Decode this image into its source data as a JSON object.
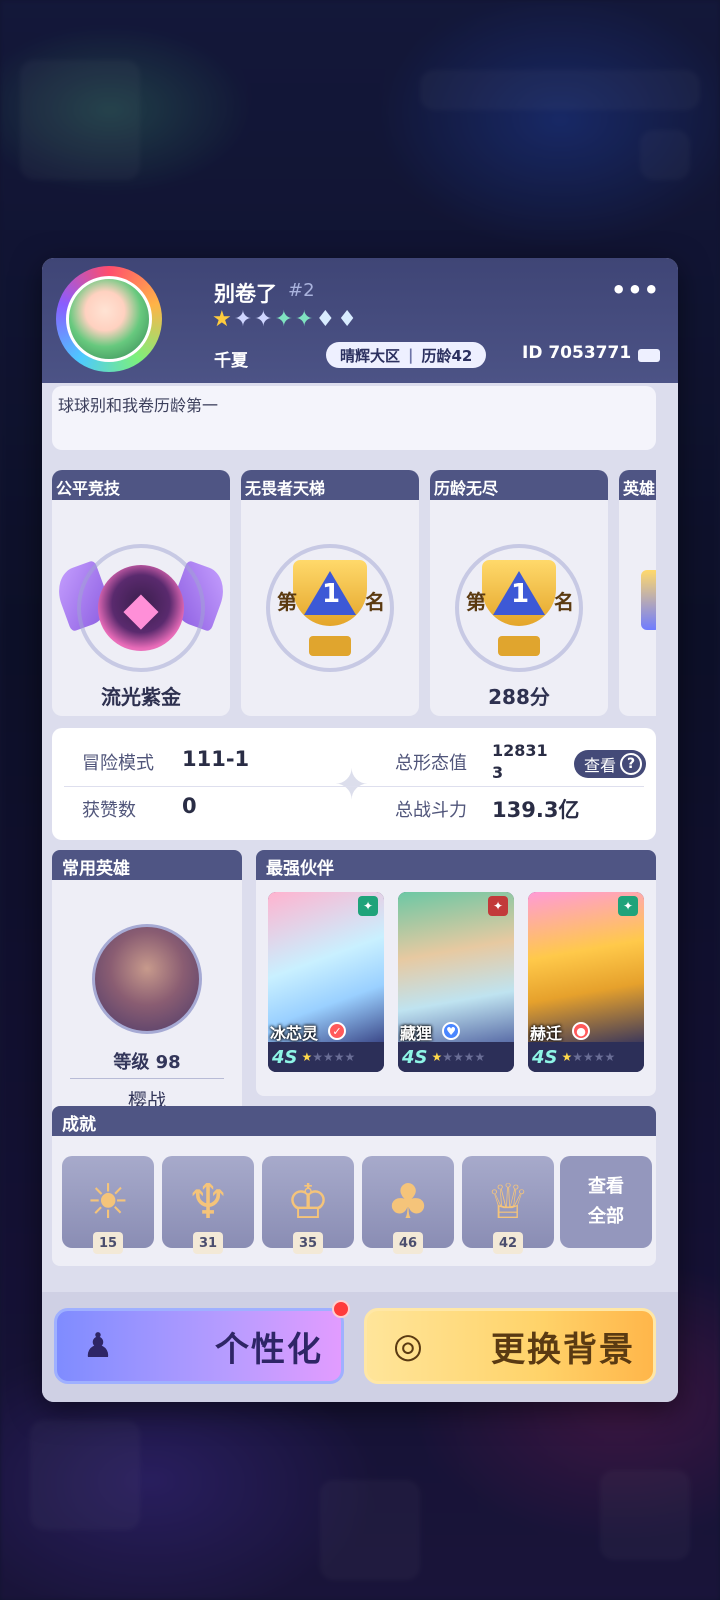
{
  "profile": {
    "nickname": "别卷了",
    "tag": "#2",
    "more_icon": "•••",
    "title_name": "千夏",
    "server": "晴辉大区",
    "separator": "|",
    "age_badge": "历龄42",
    "uid": "ID 7053771",
    "bio": "球球别和我卷历龄第一"
  },
  "ranks": [
    {
      "head": "公平竞技",
      "name": "流光紫金",
      "icon": "purple-gem-emblem"
    },
    {
      "head": "无畏者天梯",
      "name": "",
      "icon": "first-place-trophy",
      "left_char": "第",
      "num": "1",
      "right_char": "名"
    },
    {
      "head": "历龄无尽",
      "name": "288分",
      "icon": "first-place-trophy",
      "left_char": "第",
      "num": "1",
      "right_char": "名"
    },
    {
      "head": "英雄",
      "name": "",
      "icon": "partial-card"
    }
  ],
  "stats": {
    "adventure_label": "冒险模式",
    "adventure_value": "111-1",
    "total_form_label": "总形态值",
    "total_form_value": "128313",
    "likes_label": "获赞数",
    "likes_value": "0",
    "power_label": "总战斗力",
    "power_value": "139.3亿",
    "view_label": "查看",
    "view_icon": "?"
  },
  "common_hero": {
    "head": "常用英雄",
    "level": "等级 98",
    "name": "樱战"
  },
  "partners": {
    "head": "最强伙伴",
    "items": [
      {
        "name": "冰芯灵",
        "grade": "4S",
        "stars_on": 1,
        "stars_total": 5,
        "badge_color": "#1fa37a",
        "elem_color": "#ff5a5a"
      },
      {
        "name": "藏狸",
        "grade": "4S",
        "stars_on": 1,
        "stars_total": 5,
        "badge_color": "#c23a3a",
        "elem_color": "#4a86ff"
      },
      {
        "name": "赫迁",
        "grade": "4S",
        "stars_on": 1,
        "stars_total": 5,
        "badge_color": "#1fa37a",
        "elem_color": "#ff5a5a"
      }
    ]
  },
  "achievements": {
    "head": "成就",
    "items": [
      {
        "num": "15",
        "icon": "sun-medal-icon"
      },
      {
        "num": "31",
        "icon": "fan-medal-icon"
      },
      {
        "num": "35",
        "icon": "crown-medal-icon"
      },
      {
        "num": "46",
        "icon": "tree-medal-icon"
      },
      {
        "num": "42",
        "icon": "royal-crown-icon"
      }
    ],
    "view_all_line1": "查看",
    "view_all_line2": "全部"
  },
  "buttons": {
    "personalize": "个性化",
    "change_background": "更换背景"
  },
  "colors": {
    "header": "#4c5386",
    "section_head": "#4f5584",
    "panel": "#dcdded",
    "personalize_btn": "#9aa0ff",
    "background_btn": "#ffd36a"
  }
}
